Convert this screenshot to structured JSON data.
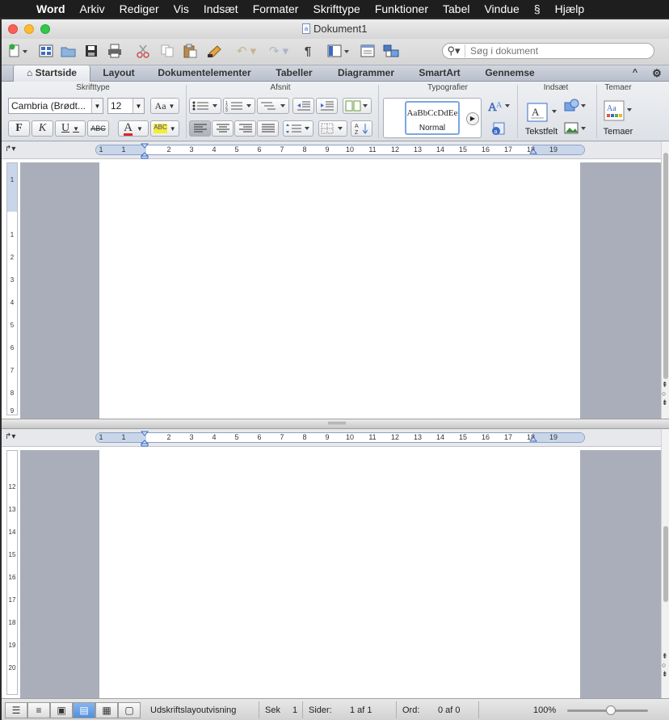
{
  "menubar": {
    "apple_icon": "apple-icon",
    "app_name": "Word",
    "items": [
      "Arkiv",
      "Rediger",
      "Vis",
      "Indsæt",
      "Formater",
      "Skrifttype",
      "Funktioner",
      "Tabel",
      "Vindue",
      "Hjælp"
    ],
    "script_icon": "script-menu-icon"
  },
  "window": {
    "title": "Dokument1",
    "title_icon": "a"
  },
  "toolbar": {
    "search_placeholder": "Søg i dokument",
    "pilcrow": "¶"
  },
  "ribbon_tabs": [
    "Startside",
    "Layout",
    "Dokumentelementer",
    "Tabeller",
    "Diagrammer",
    "SmartArt",
    "Gennemse"
  ],
  "ribbon": {
    "font_group": "Skrifttype",
    "paragraph_group": "Afsnit",
    "styles_group": "Typografier",
    "insert_group": "Indsæt",
    "themes_group": "Temaer",
    "font_name": "Cambria (Brødt...",
    "font_size": "12",
    "case_label": "Aa",
    "bold": "F",
    "italic": "K",
    "underline": "U",
    "strike": "ABC",
    "font_color": "A",
    "highlight": "ABC",
    "style_preview": "AaBbCcDdEe",
    "style_name": "Normal",
    "textbox_label": "Tekstfelt",
    "themes_label": "Temaer"
  },
  "ruler": {
    "numbers": [
      "1",
      "1",
      "2",
      "3",
      "4",
      "5",
      "6",
      "7",
      "8",
      "9",
      "10",
      "11",
      "12",
      "13",
      "14",
      "15",
      "16",
      "17",
      "18",
      "19"
    ]
  },
  "vruler_top": [
    "1",
    "1",
    "2",
    "3",
    "4",
    "5",
    "6",
    "7",
    "8",
    "9"
  ],
  "vruler_bottom": [
    "12",
    "13",
    "14",
    "15",
    "16",
    "17",
    "18",
    "19",
    "20"
  ],
  "statusbar": {
    "view_name": "Udskriftslayoutvisning",
    "section_label": "Sek",
    "section_value": "1",
    "pages_label": "Sider:",
    "pages_value": "1 af 1",
    "words_label": "Ord:",
    "words_value": "0 af 0",
    "zoom": "100%"
  },
  "colors": {
    "accent": "#4f8ee0",
    "gutter": "#a9aeba",
    "menubar": "#1e1e1e"
  }
}
